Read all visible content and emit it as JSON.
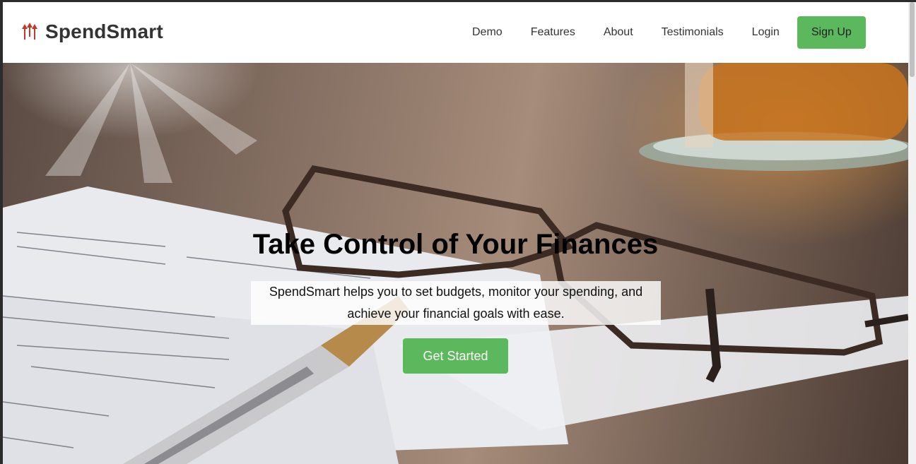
{
  "brand": {
    "name": "SpendSmart",
    "icon": "triple-arrow-logo-icon",
    "icon_color": "#c0392b"
  },
  "nav": {
    "items": [
      {
        "label": "Demo"
      },
      {
        "label": "Features"
      },
      {
        "label": "About"
      },
      {
        "label": "Testimonials"
      },
      {
        "label": "Login"
      }
    ],
    "signup_label": "Sign Up"
  },
  "hero": {
    "title": "Take Control of Your Finances",
    "subtitle": "SpendSmart helps you to set budgets, monitor your spending, and achieve your financial goals with ease.",
    "cta_label": "Get Started",
    "background_description_icon": "finance-desk-photo"
  },
  "colors": {
    "accent": "#5cb85c",
    "text": "#333333"
  }
}
